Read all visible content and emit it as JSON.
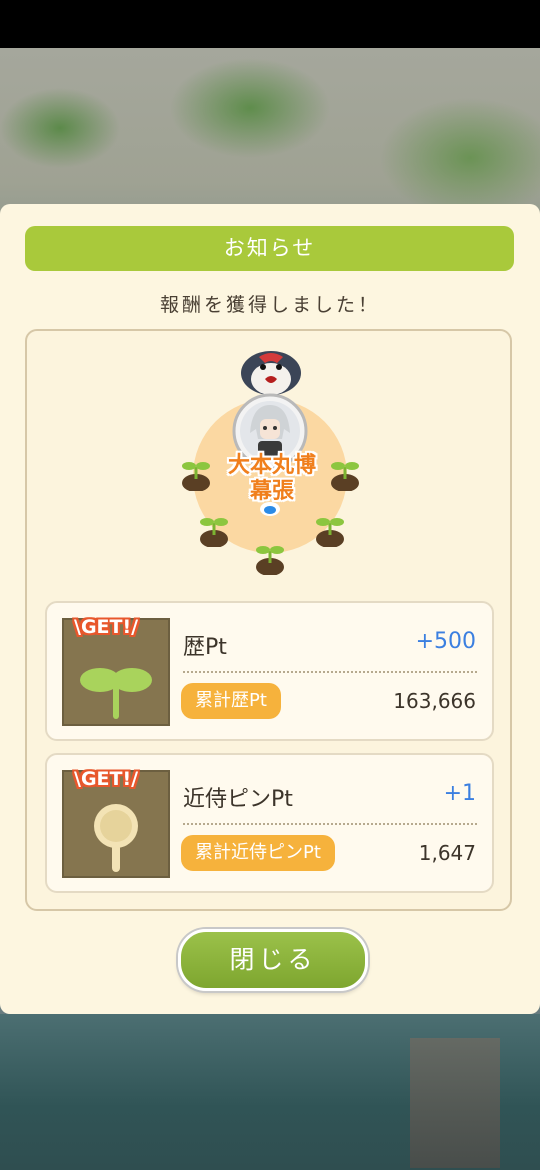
{
  "dialog": {
    "title": "お知らせ",
    "subtitle": "報酬を獲得しました！",
    "spot_name_line1": "大本丸博",
    "spot_name_line2": "幕張",
    "close_label": "閉じる"
  },
  "rewards": [
    {
      "badge": "\\GET!/",
      "name": "歴Pt",
      "gain": "+500",
      "total_label": "累計歴Pt",
      "total_value": "163,666",
      "icon": "sprout-icon"
    },
    {
      "badge": "\\GET!/",
      "name": "近侍ピンPt",
      "gain": "+1",
      "total_label": "累計近侍ピンPt",
      "total_value": "1,647",
      "icon": "pin-icon"
    }
  ],
  "colors": {
    "title_bar": "#a9c93b",
    "gain_text": "#3b7fe0",
    "pill": "#f6b23c",
    "spot_name": "#f07f1c"
  }
}
